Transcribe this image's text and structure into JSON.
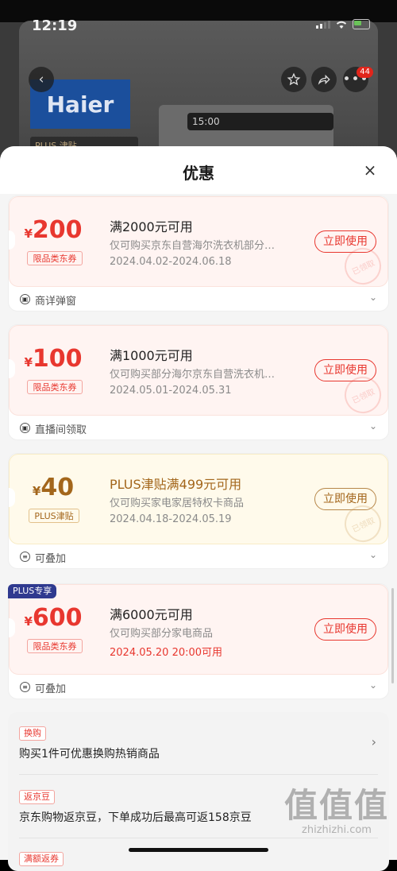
{
  "status_bar": {
    "time": "12:19"
  },
  "background": {
    "brand_logo": "Haier",
    "plus_tag": "PLUS 津贴",
    "washer_display": "15:00",
    "cart_badge": "44"
  },
  "sheet": {
    "title": "优惠",
    "close": "×"
  },
  "coupons": [
    {
      "currency": "¥",
      "amount": "200",
      "type": "限品类东券",
      "title": "满2000元可用",
      "desc": "仅可购买京东自营海尔洗衣机部分…",
      "date": "2024.04.02-2024.06.18",
      "button": "立即使用",
      "stamp": "已领取",
      "footer": "商详弹窗"
    },
    {
      "currency": "¥",
      "amount": "100",
      "type": "限品类东券",
      "title": "满1000元可用",
      "desc": "仅可购买部分海尔京东自营洗衣机…",
      "date": "2024.05.01-2024.05.31",
      "button": "立即使用",
      "stamp": "已领取",
      "footer": "直播间领取"
    },
    {
      "currency": "¥",
      "amount": "40",
      "type": "PLUS津贴",
      "title": "PLUS津贴满499元可用",
      "desc": "仅可购买家电家居特权卡商品",
      "date": "2024.04.18-2024.05.19",
      "button": "立即使用",
      "stamp": "已领取",
      "footer": "可叠加"
    },
    {
      "badge": "PLUS专享",
      "currency": "¥",
      "amount": "600",
      "type": "限品类东券",
      "title": "满6000元可用",
      "desc": "仅可购买部分家电商品",
      "date": "2024.05.20 20:00可用",
      "button": "立即使用",
      "footer": "可叠加"
    }
  ],
  "promotions": [
    {
      "tag": "换购",
      "text": "购买1件可优惠换购热销商品"
    },
    {
      "tag": "返京豆",
      "text": "京东购物返京豆，下单成功后最高可返158京豆"
    },
    {
      "tag": "满额返券"
    }
  ],
  "watermark": {
    "big": "值值值",
    "small": "zhizhizhi.com"
  },
  "colors": {
    "accent_red": "#e8372f",
    "plus_gold": "#a3661b",
    "plus_badge_blue": "#2f3a8f"
  }
}
